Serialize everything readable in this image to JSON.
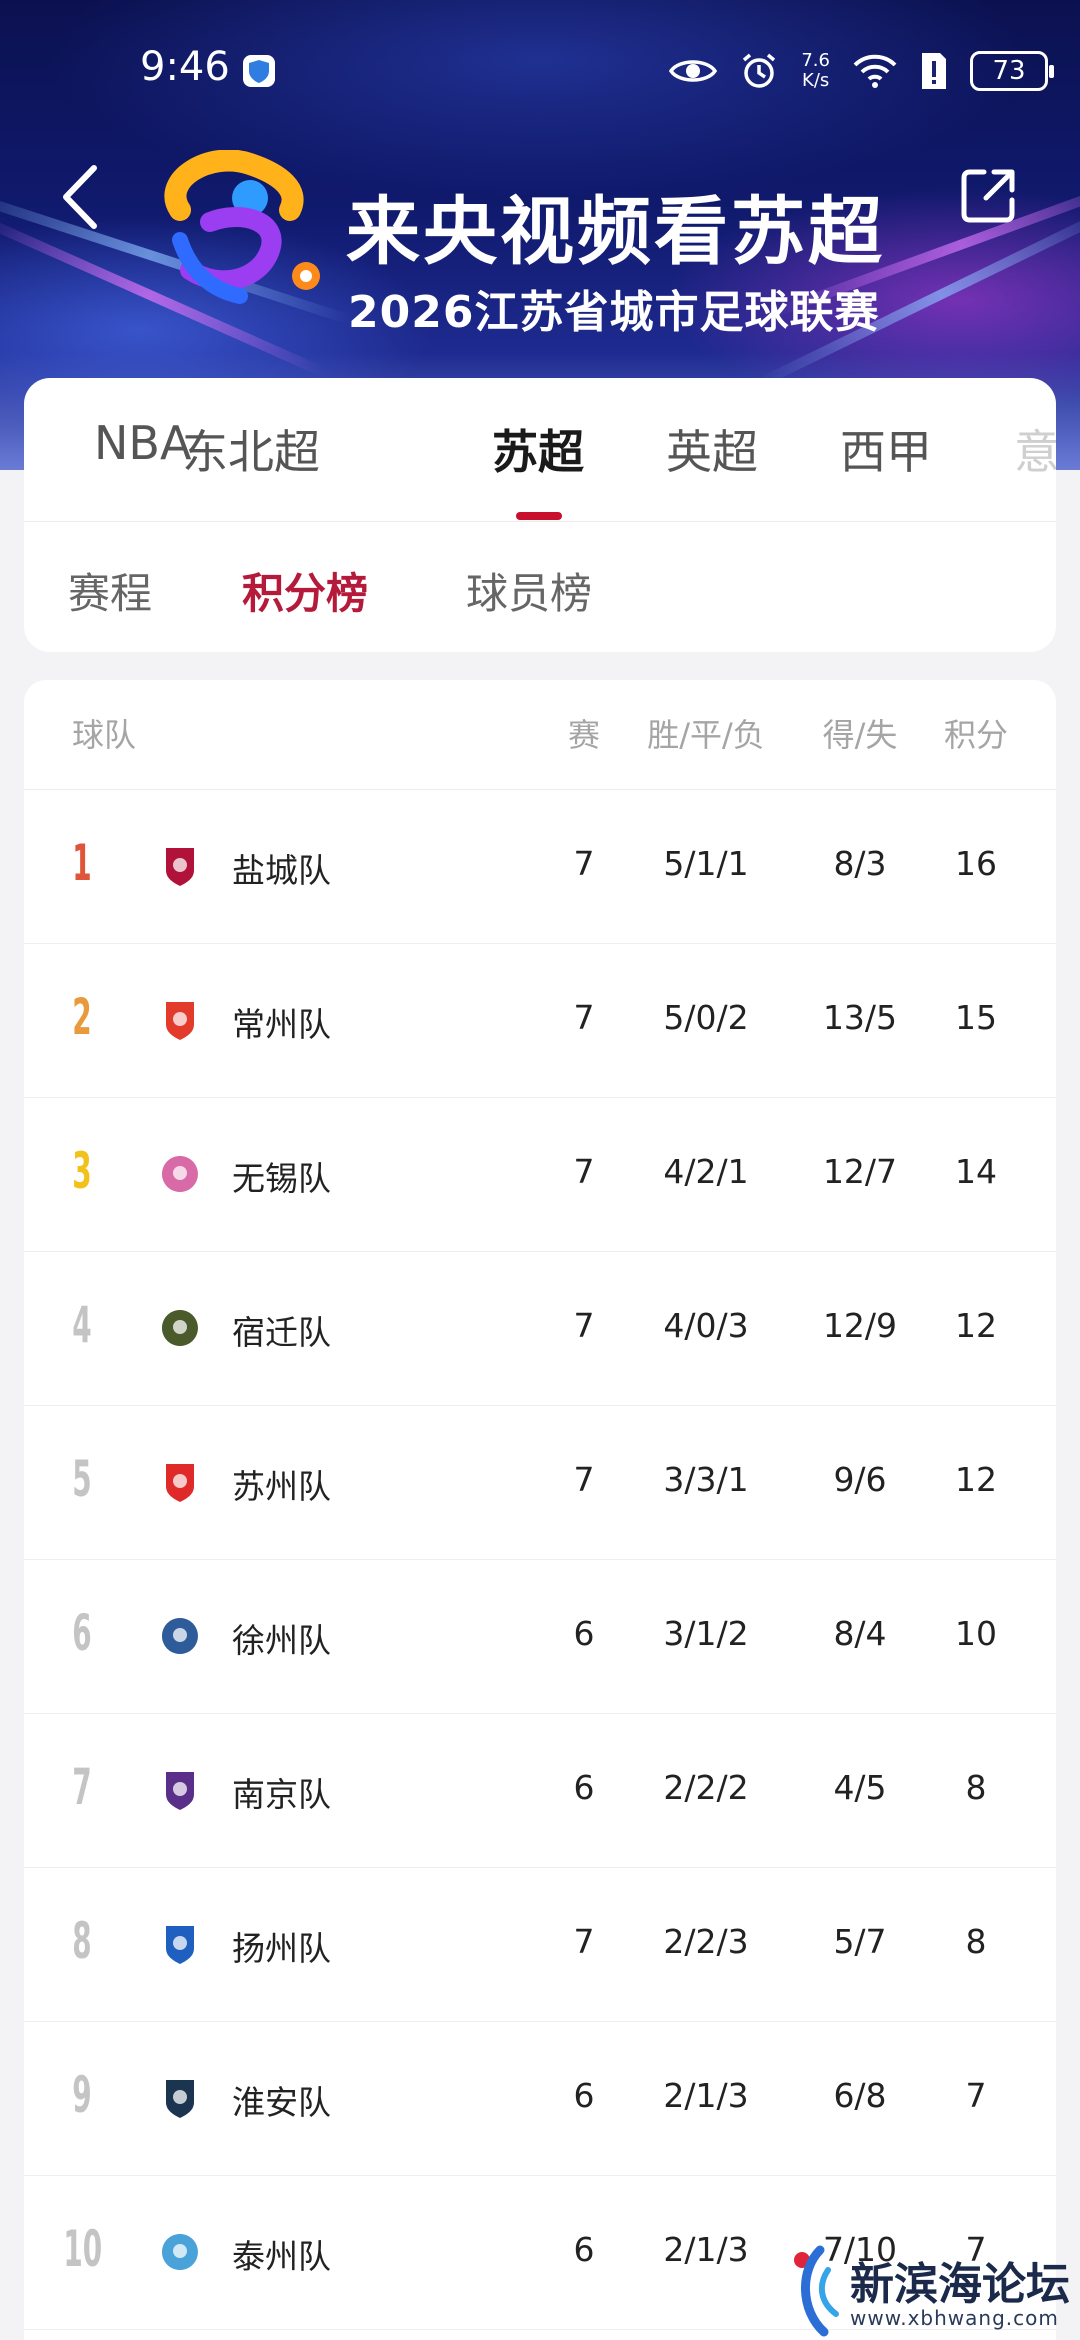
{
  "status_bar": {
    "time": "9:46",
    "net_speed_value": "7.6",
    "net_speed_unit": "K/s",
    "battery": "73"
  },
  "header": {
    "title": "来央视频看苏超",
    "subtitle": "2026江苏省城市足球联赛"
  },
  "league_tabs": [
    {
      "label": "NBA",
      "active": false
    },
    {
      "label": "东北超",
      "active": false
    },
    {
      "label": "苏超",
      "active": true
    },
    {
      "label": "英超",
      "active": false
    },
    {
      "label": "西甲",
      "active": false
    },
    {
      "label": "意",
      "active": false
    }
  ],
  "sub_tabs": [
    {
      "label": "赛程",
      "active": false
    },
    {
      "label": "积分榜",
      "active": true
    },
    {
      "label": "球员榜",
      "active": false
    }
  ],
  "table": {
    "headers": {
      "team": "球队",
      "played": "赛",
      "wdl": "胜/平/负",
      "goals": "得/失",
      "points": "积分"
    },
    "rows": [
      {
        "rank": "1",
        "team": "盐城队",
        "played": "7",
        "wdl": "5/1/1",
        "goals": "8/3",
        "points": "16"
      },
      {
        "rank": "2",
        "team": "常州队",
        "played": "7",
        "wdl": "5/0/2",
        "goals": "13/5",
        "points": "15"
      },
      {
        "rank": "3",
        "team": "无锡队",
        "played": "7",
        "wdl": "4/2/1",
        "goals": "12/7",
        "points": "14"
      },
      {
        "rank": "4",
        "team": "宿迁队",
        "played": "7",
        "wdl": "4/0/3",
        "goals": "12/9",
        "points": "12"
      },
      {
        "rank": "5",
        "team": "苏州队",
        "played": "7",
        "wdl": "3/3/1",
        "goals": "9/6",
        "points": "12"
      },
      {
        "rank": "6",
        "team": "徐州队",
        "played": "6",
        "wdl": "3/1/2",
        "goals": "8/4",
        "points": "10"
      },
      {
        "rank": "7",
        "team": "南京队",
        "played": "6",
        "wdl": "2/2/2",
        "goals": "4/5",
        "points": "8"
      },
      {
        "rank": "8",
        "team": "扬州队",
        "played": "7",
        "wdl": "2/2/3",
        "goals": "5/7",
        "points": "8"
      },
      {
        "rank": "9",
        "team": "淮安队",
        "played": "6",
        "wdl": "2/1/3",
        "goals": "6/8",
        "points": "7"
      },
      {
        "rank": "10",
        "team": "泰州队",
        "played": "6",
        "wdl": "2/1/3",
        "goals": "7/10",
        "points": "7"
      }
    ]
  },
  "colors": {
    "accent_red": "#c8102e",
    "rank_1": "#e0553a",
    "rank_2": "#e89a3c",
    "rank_3": "#f2c21a",
    "rank_other": "#c4c4c4"
  },
  "watermark": {
    "text": "新滨海论坛",
    "url": "www.xbhwang.com"
  }
}
